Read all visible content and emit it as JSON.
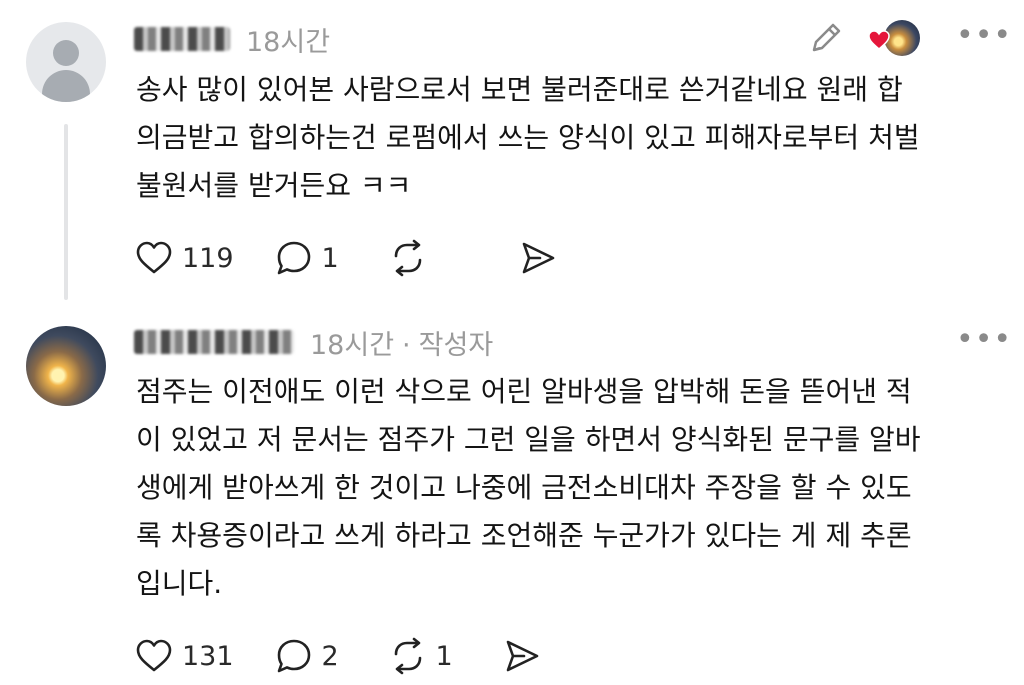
{
  "comments": [
    {
      "time": "18시간",
      "body": "송사 많이 있어본 사람으로서 보면 불러준대로 쓴거같네요 원래 합\n의금받고 합의하는건 로펌에서 쓰는 양식이 있고 피해자로부터 처벌\n불원서를 받거든요 ㅋㅋ",
      "likes": "119",
      "replies": "1",
      "reposts": ""
    },
    {
      "time": "18시간",
      "separator": "·",
      "author_badge": "작성자",
      "body": "점주는 이전애도 이런 삭으로 어린 알바생을 압박해 돈을 뜯어낸 적\n이 있었고 저 문서는 점주가 그런 일을 하면서 양식화된 문구를 알바\n생에게 받아쓰게 한 것이고 나중에 금전소비대차 주장을 할 수 있도\n록 차용증이라고 쓰게 하라고 조언해준 누군가가 있다는 게 제 추론\n입니다.",
      "likes": "131",
      "replies": "2",
      "reposts": "1"
    }
  ],
  "icons": {
    "more": "•••",
    "like": "heart-icon",
    "reply": "reply-bubble-icon",
    "repost": "repost-icon",
    "share": "send-icon",
    "edit": "pencil-icon",
    "liked_by_author": "red-heart-icon"
  },
  "colors": {
    "meta": "#9a9a9a",
    "text": "#141414",
    "heart": "#e5163b"
  }
}
